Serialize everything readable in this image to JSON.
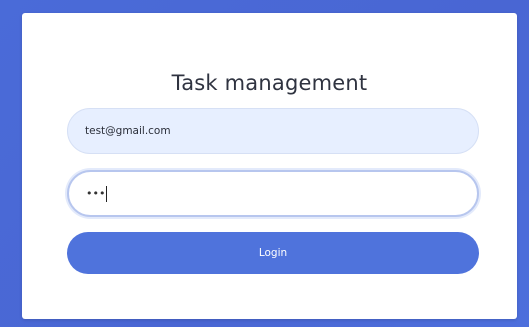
{
  "app": {
    "title": "Task management"
  },
  "form": {
    "email_value": "test@gmail.com",
    "password_masked": "•••",
    "login_label": "Login"
  },
  "colors": {
    "background": "#4966d3",
    "accent": "#4f73dc",
    "email_field_bg": "#e7efff"
  }
}
